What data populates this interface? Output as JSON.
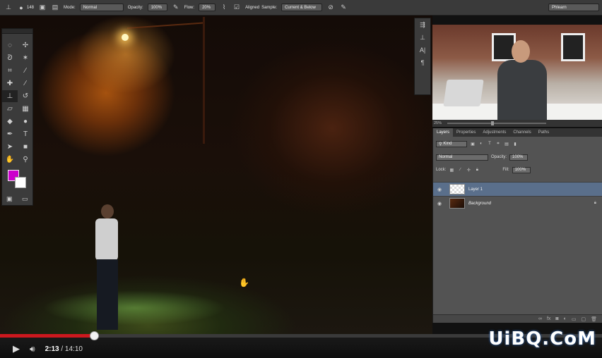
{
  "optionsbar": {
    "brush_size": "148",
    "mode_label": "Mode:",
    "mode_value": "Normal",
    "opacity_label": "Opacity:",
    "opacity_value": "100%",
    "flow_label": "Flow:",
    "flow_value": "20%",
    "aligned_label": "Aligned",
    "sample_label": "Sample:",
    "sample_value": "Current & Below",
    "workspace": "Phlearn"
  },
  "statusbar": {
    "zoom": "25%"
  },
  "layers_panel": {
    "tabs": [
      "Layers",
      "Properties",
      "Adjustments",
      "Channels",
      "Paths"
    ],
    "filter_label": "Kind",
    "blend_mode": "Normal",
    "opacity_label": "Opacity:",
    "opacity_value": "100%",
    "lock_label": "Lock:",
    "fill_label": "Fill:",
    "fill_value": "100%",
    "layers": [
      {
        "name": "Layer 1",
        "selected": true
      },
      {
        "name": "Background",
        "selected": false,
        "locked": true
      }
    ]
  },
  "swatches": {
    "foreground": "#cc00cc",
    "background": "#ffffff"
  },
  "player": {
    "current_time": "2:13",
    "separator": " / ",
    "duration": "14:10",
    "progress_fraction": 0.156
  },
  "watermark": "UiBQ.CoM"
}
